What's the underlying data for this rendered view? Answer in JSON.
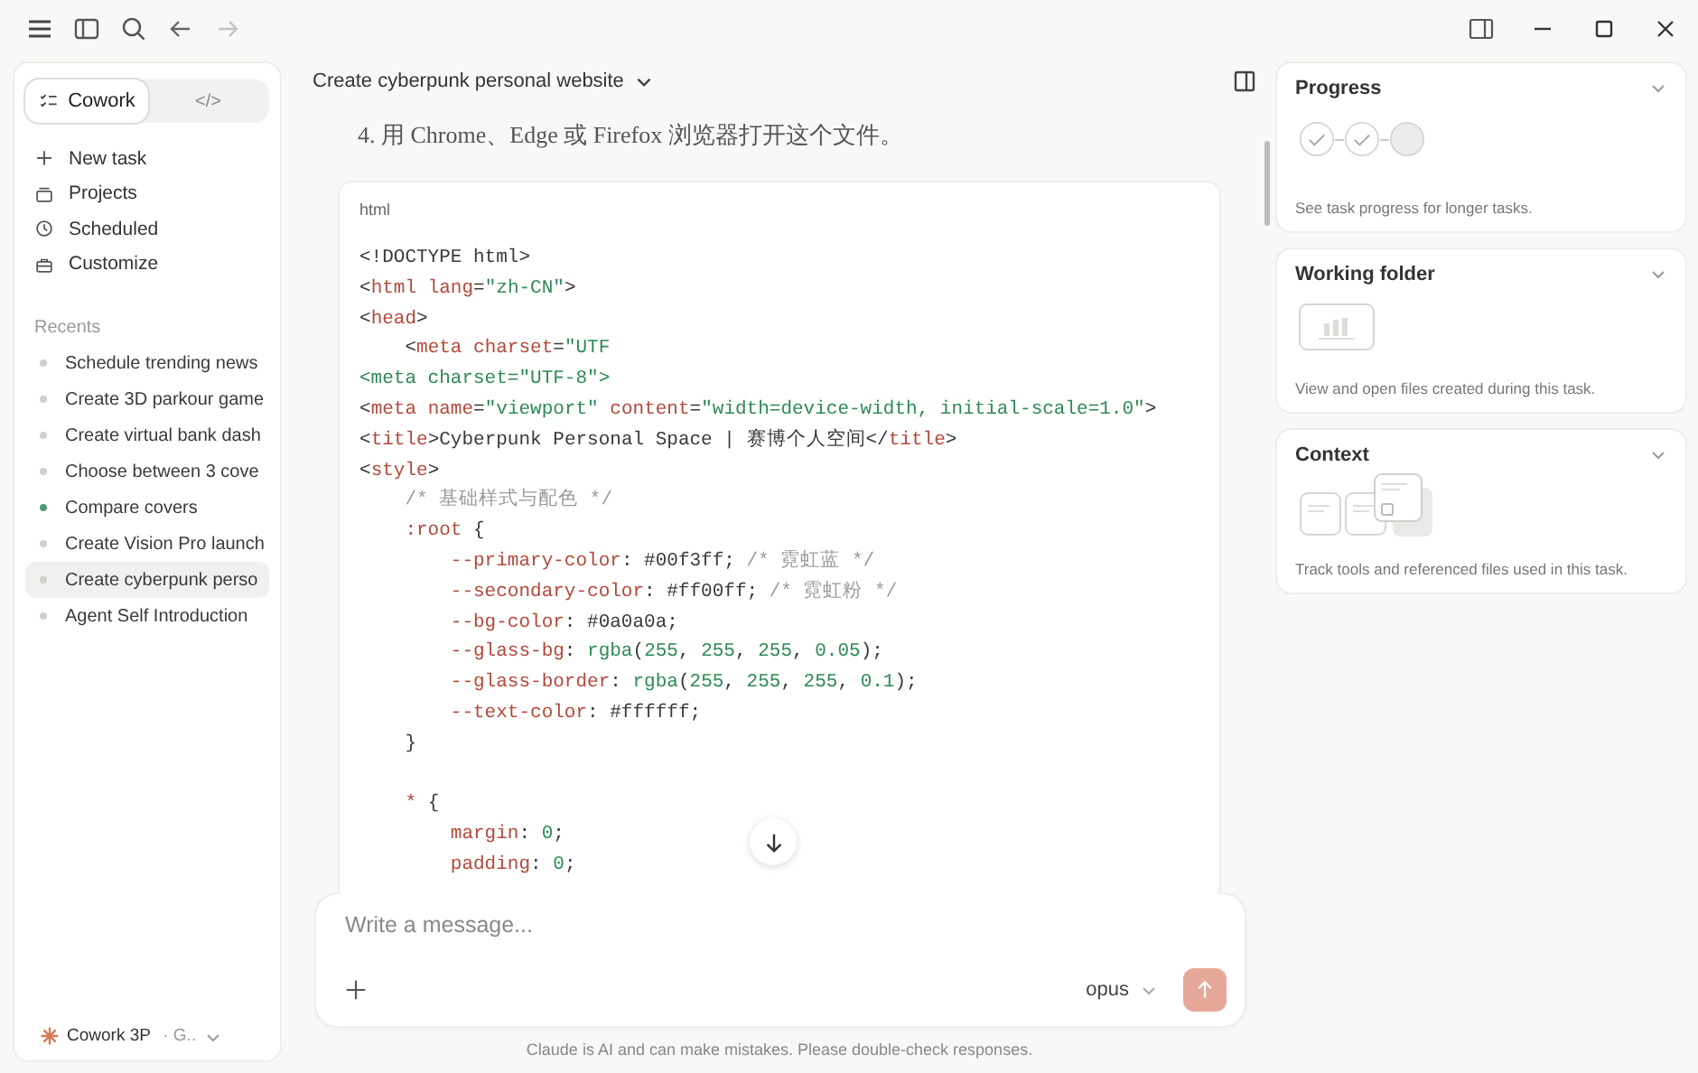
{
  "window": {
    "nav": {
      "back_disabled": false,
      "forward_disabled": true
    }
  },
  "sidebar": {
    "modes": [
      {
        "label": "Cowork",
        "selected": true
      },
      {
        "label": "</>",
        "selected": false
      }
    ],
    "items": [
      {
        "label": "New task"
      },
      {
        "label": "Projects"
      },
      {
        "label": "Scheduled"
      },
      {
        "label": "Customize"
      }
    ],
    "recents_heading": "Recents",
    "recents": [
      {
        "label": "Schedule trending news",
        "color": "#cfcfcc",
        "selected": false
      },
      {
        "label": "Create 3D parkour game",
        "color": "#cfcfcc",
        "selected": false
      },
      {
        "label": "Create virtual bank dash",
        "color": "#cfcfcc",
        "selected": false
      },
      {
        "label": "Choose between 3 cove",
        "color": "#cfcfcc",
        "selected": false
      },
      {
        "label": "Compare covers",
        "color": "#4f9a72",
        "selected": false
      },
      {
        "label": "Create Vision Pro launch",
        "color": "#cfcfcc",
        "selected": false
      },
      {
        "label": "Create cyberpunk perso",
        "color": "#cfcfcc",
        "selected": true
      },
      {
        "label": "Agent Self Introduction",
        "color": "#cfcfcc",
        "selected": false
      }
    ],
    "account": {
      "name": "Cowork 3P",
      "detail": " · G.."
    }
  },
  "chat": {
    "title": "Create cyberpunk personal website",
    "step": "4. 用 Chrome、Edge 或 Firefox 浏览器打开这个文件。",
    "code": {
      "language": "html",
      "lines": [
        [
          {
            "text": "<!DOCTYPE html>",
            "kind": "plain"
          }
        ],
        [
          {
            "text": "<",
            "kind": "plain"
          },
          {
            "text": "html lang",
            "kind": "tag"
          },
          {
            "text": "=",
            "kind": "plain"
          },
          {
            "text": "\"zh-CN\"",
            "kind": "string"
          },
          {
            "text": ">",
            "kind": "plain"
          }
        ],
        [
          {
            "text": "<",
            "kind": "plain"
          },
          {
            "text": "head",
            "kind": "tag"
          },
          {
            "text": ">",
            "kind": "plain"
          }
        ],
        [
          {
            "text": "    <",
            "kind": "plain"
          },
          {
            "text": "meta charset",
            "kind": "tag"
          },
          {
            "text": "=",
            "kind": "plain"
          },
          {
            "text": "\"UTF",
            "kind": "string"
          }
        ],
        [
          {
            "text": "<meta charset=\"UTF-8\">",
            "kind": "string"
          }
        ],
        [
          {
            "text": "<",
            "kind": "plain"
          },
          {
            "text": "meta name",
            "kind": "tag"
          },
          {
            "text": "=",
            "kind": "plain"
          },
          {
            "text": "\"viewport\"",
            "kind": "string"
          },
          {
            "text": " content",
            "kind": "tag"
          },
          {
            "text": "=",
            "kind": "plain"
          },
          {
            "text": "\"width=device-width, initial-scale=1.0\"",
            "kind": "string"
          },
          {
            "text": ">",
            "kind": "plain"
          }
        ],
        [
          {
            "text": "<",
            "kind": "plain"
          },
          {
            "text": "title",
            "kind": "tag"
          },
          {
            "text": ">Cyberpunk Personal Space | 赛博个人空间</",
            "kind": "plain"
          },
          {
            "text": "title",
            "kind": "tag"
          },
          {
            "text": ">",
            "kind": "plain"
          }
        ],
        [
          {
            "text": "<",
            "kind": "plain"
          },
          {
            "text": "style",
            "kind": "tag"
          },
          {
            "text": ">",
            "kind": "plain"
          }
        ],
        [
          {
            "text": "    /* 基础样式与配色 */",
            "kind": "comment"
          }
        ],
        [
          {
            "text": "    :root",
            "kind": "tag"
          },
          {
            "text": " {",
            "kind": "plain"
          }
        ],
        [
          {
            "text": "        --primary-color",
            "kind": "tag"
          },
          {
            "text": ": #00f3ff; ",
            "kind": "plain"
          },
          {
            "text": "/* 霓虹蓝 */",
            "kind": "comment"
          }
        ],
        [
          {
            "text": "        --secondary-color",
            "kind": "tag"
          },
          {
            "text": ": #ff00ff; ",
            "kind": "plain"
          },
          {
            "text": "/* 霓虹粉 */",
            "kind": "comment"
          }
        ],
        [
          {
            "text": "        --bg-color",
            "kind": "tag"
          },
          {
            "text": ": #0a0a0a;",
            "kind": "plain"
          }
        ],
        [
          {
            "text": "        --glass-bg",
            "kind": "tag"
          },
          {
            "text": ": ",
            "kind": "plain"
          },
          {
            "text": "rgba",
            "kind": "string"
          },
          {
            "text": "(",
            "kind": "plain"
          },
          {
            "text": "255",
            "kind": "string"
          },
          {
            "text": ", ",
            "kind": "plain"
          },
          {
            "text": "255",
            "kind": "string"
          },
          {
            "text": ", ",
            "kind": "plain"
          },
          {
            "text": "255",
            "kind": "string"
          },
          {
            "text": ", ",
            "kind": "plain"
          },
          {
            "text": "0.05",
            "kind": "string"
          },
          {
            "text": ");",
            "kind": "plain"
          }
        ],
        [
          {
            "text": "        --glass-border",
            "kind": "tag"
          },
          {
            "text": ": ",
            "kind": "plain"
          },
          {
            "text": "rgba",
            "kind": "string"
          },
          {
            "text": "(",
            "kind": "plain"
          },
          {
            "text": "255",
            "kind": "string"
          },
          {
            "text": ", ",
            "kind": "plain"
          },
          {
            "text": "255",
            "kind": "string"
          },
          {
            "text": ", ",
            "kind": "plain"
          },
          {
            "text": "255",
            "kind": "string"
          },
          {
            "text": ", ",
            "kind": "plain"
          },
          {
            "text": "0.1",
            "kind": "string"
          },
          {
            "text": ");",
            "kind": "plain"
          }
        ],
        [
          {
            "text": "        --text-color",
            "kind": "tag"
          },
          {
            "text": ": #ffffff;",
            "kind": "plain"
          }
        ],
        [
          {
            "text": "    }",
            "kind": "plain"
          }
        ],
        [
          {
            "text": "    *",
            "kind": "tag"
          },
          {
            "text": " {",
            "kind": "plain",
            "blank_line_before": true
          }
        ],
        [
          {
            "text": "        margin",
            "kind": "tag"
          },
          {
            "text": ": ",
            "kind": "plain"
          },
          {
            "text": "0",
            "kind": "string"
          },
          {
            "text": ";",
            "kind": "plain"
          }
        ],
        [
          {
            "text": "        padding",
            "kind": "tag"
          },
          {
            "text": ": ",
            "kind": "plain"
          },
          {
            "text": "0",
            "kind": "string"
          },
          {
            "text": ";",
            "kind": "plain"
          }
        ]
      ]
    },
    "composer": {
      "placeholder": "Write a message...",
      "model": "opus",
      "send_disabled": true
    },
    "disclaimer": "Claude is AI and can make mistakes. Please double-check responses."
  },
  "panels": [
    {
      "kind": "progress",
      "title": "Progress",
      "steps": [
        {
          "done": true
        },
        {
          "done": true
        },
        {
          "done": false
        }
      ],
      "description": "See task progress for longer tasks."
    },
    {
      "kind": "folder",
      "title": "Working folder",
      "description": "View and open files created during this task."
    },
    {
      "kind": "context",
      "title": "Context",
      "description": "Track tools and referenced files used in this task."
    }
  ]
}
